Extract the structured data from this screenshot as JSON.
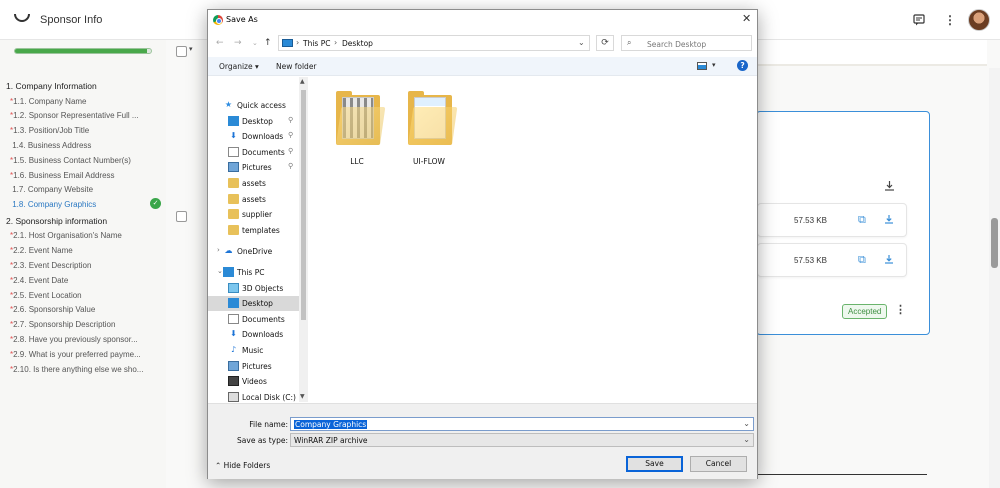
{
  "app": {
    "title": "Sponsor Info",
    "progress_fraction": 0.97
  },
  "sidebar": {
    "sections": [
      {
        "title": "1. Company Information",
        "items": [
          {
            "num": "1.1.",
            "label": "Company Name",
            "required": true
          },
          {
            "num": "1.2.",
            "label": "Sponsor Representative Full ...",
            "required": true
          },
          {
            "num": "1.3.",
            "label": "Position/Job Title",
            "required": true
          },
          {
            "num": "1.4.",
            "label": "Business Address",
            "required": false
          },
          {
            "num": "1.5.",
            "label": "Business Contact Number(s)",
            "required": true
          },
          {
            "num": "1.6.",
            "label": "Business Email Address",
            "required": true
          },
          {
            "num": "1.7.",
            "label": "Company Website",
            "required": false
          },
          {
            "num": "1.8.",
            "label": "Company Graphics",
            "required": false,
            "active": true
          }
        ]
      },
      {
        "title": "2. Sponsorship information",
        "items": [
          {
            "num": "2.1.",
            "label": "Host Organisation's Name",
            "required": true
          },
          {
            "num": "2.2.",
            "label": "Event Name",
            "required": true
          },
          {
            "num": "2.3.",
            "label": "Event Description",
            "required": true
          },
          {
            "num": "2.4.",
            "label": "Event Date",
            "required": true
          },
          {
            "num": "2.5.",
            "label": "Event Location",
            "required": true
          },
          {
            "num": "2.6.",
            "label": "Sponsorship Value",
            "required": true
          },
          {
            "num": "2.7.",
            "label": "Sponsorship Description",
            "required": true
          },
          {
            "num": "2.8.",
            "label": "Have you previously sponsor...",
            "required": true
          },
          {
            "num": "2.9.",
            "label": "What is your preferred payme...",
            "required": true
          },
          {
            "num": "2.10.",
            "label": "Is there anything else we sho...",
            "required": true
          }
        ]
      }
    ]
  },
  "files_card": {
    "files": [
      {
        "size": "57.53 KB"
      },
      {
        "size": "57.53 KB"
      }
    ],
    "status": "Accepted"
  },
  "dialog": {
    "title": "Save As",
    "path": [
      "This PC",
      "Desktop"
    ],
    "search_placeholder": "Search Desktop",
    "organize": "Organize",
    "new_folder": "New folder",
    "tree": [
      {
        "label": "Quick access",
        "icon": "star-icon"
      },
      {
        "label": "Desktop",
        "icon": "desktop-icon",
        "pinned": true
      },
      {
        "label": "Downloads",
        "icon": "download-icon",
        "pinned": true
      },
      {
        "label": "Documents",
        "icon": "documents-icon",
        "pinned": true
      },
      {
        "label": "Pictures",
        "icon": "pictures-icon",
        "pinned": true
      },
      {
        "label": "assets",
        "icon": "folder-icon"
      },
      {
        "label": "assets",
        "icon": "folder-icon"
      },
      {
        "label": "supplier",
        "icon": "folder-icon"
      },
      {
        "label": "templates",
        "icon": "folder-icon"
      },
      {
        "label": "OneDrive",
        "icon": "cloud-icon"
      },
      {
        "label": "This PC",
        "icon": "pc-icon"
      },
      {
        "label": "3D Objects",
        "icon": "3d-objects-icon"
      },
      {
        "label": "Desktop",
        "icon": "desktop-icon",
        "selected": true
      },
      {
        "label": "Documents",
        "icon": "documents-icon"
      },
      {
        "label": "Downloads",
        "icon": "download-icon"
      },
      {
        "label": "Music",
        "icon": "music-icon"
      },
      {
        "label": "Pictures",
        "icon": "pictures-icon"
      },
      {
        "label": "Videos",
        "icon": "videos-icon"
      },
      {
        "label": "Local Disk (C:)",
        "icon": "disk-icon"
      }
    ],
    "folders": [
      {
        "name": "LLC"
      },
      {
        "name": "UI-FLOW"
      }
    ],
    "file_name_label": "File name:",
    "file_name": "Company Graphics",
    "save_type_label": "Save as type:",
    "save_type": "WinRAR ZIP archive",
    "hide_folders": "Hide Folders",
    "save": "Save",
    "cancel": "Cancel"
  },
  "colors": {
    "accent": "#2a78c2",
    "success": "#3aa64a",
    "required": "#e05050",
    "selection": "#0a64d8"
  }
}
